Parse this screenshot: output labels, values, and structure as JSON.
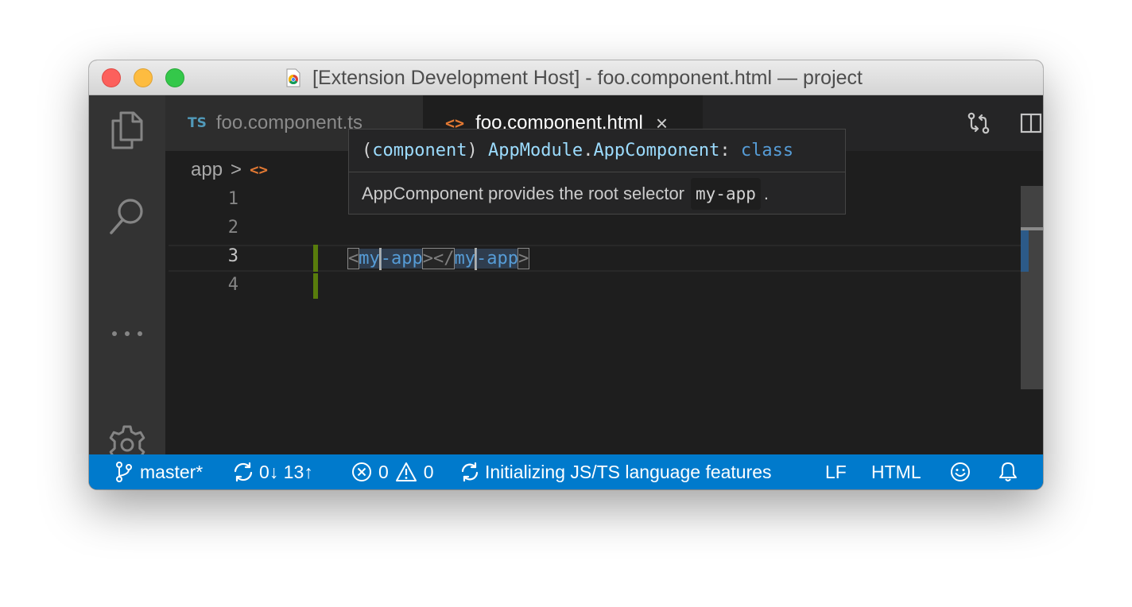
{
  "window": {
    "title": "[Extension Development Host] - foo.component.html — project"
  },
  "tabs": [
    {
      "badge": "TS",
      "label": "foo.component.ts"
    },
    {
      "badge": "<>",
      "label": "foo.component.html",
      "close": "×"
    }
  ],
  "breadcrumb": {
    "folder": "app",
    "separator": ">",
    "file_badge": "<>"
  },
  "editor": {
    "line_numbers": [
      "1",
      "2",
      "3",
      "4"
    ],
    "line3": {
      "lt": "<",
      "tag_a1": "my",
      "tag_a2": "-app",
      "gt_lt": "></",
      "tag_b1": "my",
      "tag_b2": "-app",
      "gt": ">"
    }
  },
  "hover": {
    "open_paren": "(",
    "kind": "component",
    "close_paren": ") ",
    "module": "AppModule",
    "dot": ".",
    "component": "AppComponent",
    "colon": ": ",
    "keyword": "class",
    "doc_text": "AppComponent provides the root selector",
    "doc_code": "my-app",
    "doc_end": "."
  },
  "statusbar": {
    "branch": "master*",
    "sync": "0↓ 13↑",
    "errors": "0",
    "warnings": "0",
    "progress": "Initializing JS/TS language features",
    "eol": "LF",
    "language": "HTML"
  },
  "icons": {
    "explorer": "files-icon",
    "search": "search-icon",
    "more": "ellipsis-icon",
    "settings": "gear-icon",
    "compare": "open-changes-icon",
    "split": "split-editor-icon",
    "tab_more": "more-actions-icon"
  },
  "colors": {
    "statusbar": "#007acc",
    "activitybar": "#333333",
    "editor_bg": "#1e1e1e",
    "tag": "#569cd6",
    "modified_gutter": "#587c0c"
  }
}
